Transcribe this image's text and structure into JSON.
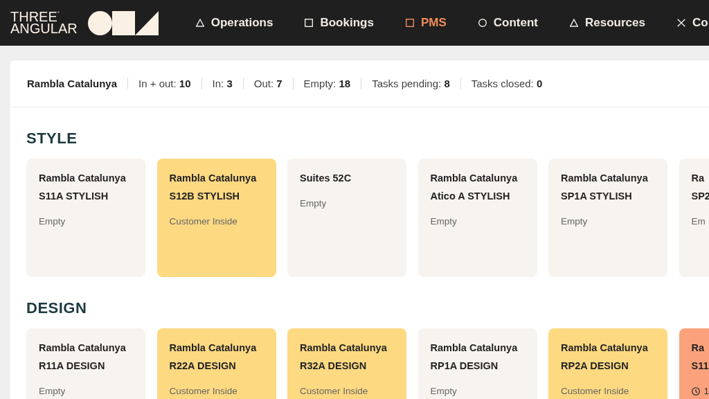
{
  "header": {
    "logo": {
      "lines": [
        "THREE$^{°}$",
        "ANGULAR"
      ]
    },
    "nav": [
      {
        "label": "Operations",
        "kind": "triangle",
        "selected": false
      },
      {
        "label": "Bookings",
        "kind": "square",
        "selected": false
      },
      {
        "label": "PMS",
        "kind": "square",
        "selected": true
      },
      {
        "label": "Content",
        "kind": "circle",
        "selected": false
      },
      {
        "label": "Resources",
        "kind": "triangle",
        "selected": false
      },
      {
        "label": "Co",
        "kind": "cross",
        "selected": false
      }
    ]
  },
  "summary": {
    "location": "Rambla Catalunya",
    "stats": [
      "In + out: **10**",
      "In: **3**",
      "Out: **7**",
      "Empty: **18**",
      "Tasks pending: **8**",
      "Tasks closed: **0**"
    ]
  },
  "sections": [
    {
      "title": "STYLE",
      "cards": [
        {
          "kind": "status",
          "title": "Rambla Catalunya",
          "subtitle": "S11A STYLISH",
          "status": "Empty",
          "color": "#f7f3ee"
        },
        {
          "kind": "status",
          "title": "Rambla Catalunya",
          "subtitle": "S12B STYLISH",
          "status": "Customer Inside",
          "color": "#fdd982"
        },
        {
          "kind": "status",
          "title": "Suites 52C",
          "status": "Empty",
          "color": "#f7f3ee"
        },
        {
          "kind": "status",
          "title": "Rambla Catalunya",
          "subtitle": "Atico A STYLISH",
          "status": "Empty",
          "color": "#f7f3ee"
        },
        {
          "kind": "status",
          "title": "Rambla Catalunya",
          "subtitle": "SP1A STYLISH",
          "status": "Empty",
          "color": "#f7f3ee"
        },
        {
          "kind": "status",
          "title": "Ra",
          "subtitle": "SP2",
          "status": "Em",
          "color": "#f7f3ee"
        }
      ]
    },
    {
      "title": "DESIGN",
      "cards": [
        {
          "kind": "status",
          "title": "Rambla Catalunya",
          "subtitle": "R11A DESIGN",
          "status": "Empty",
          "color": "#f7f3ee"
        },
        {
          "kind": "status",
          "title": "Rambla Catalunya",
          "subtitle": "R22A DESIGN",
          "status": "Customer Inside",
          "color": "#fdd982"
        },
        {
          "kind": "status",
          "title": "Rambla Catalunya",
          "subtitle": "R32A DESIGN",
          "status": "Customer Inside",
          "color": "#fdd982"
        },
        {
          "kind": "status",
          "title": "Rambla Catalunya",
          "subtitle": "RP1A DESIGN",
          "status": "Empty",
          "color": "#f7f3ee"
        },
        {
          "kind": "status",
          "title": "Rambla Catalunya",
          "subtitle": "RP2A DESIGN",
          "status": "Customer Inside",
          "color": "#fdd982"
        },
        {
          "kind": "timer",
          "title": "Ra",
          "subtitle": "S11",
          "status": "1",
          "color": "#fba27c"
        }
      ]
    }
  ]
}
